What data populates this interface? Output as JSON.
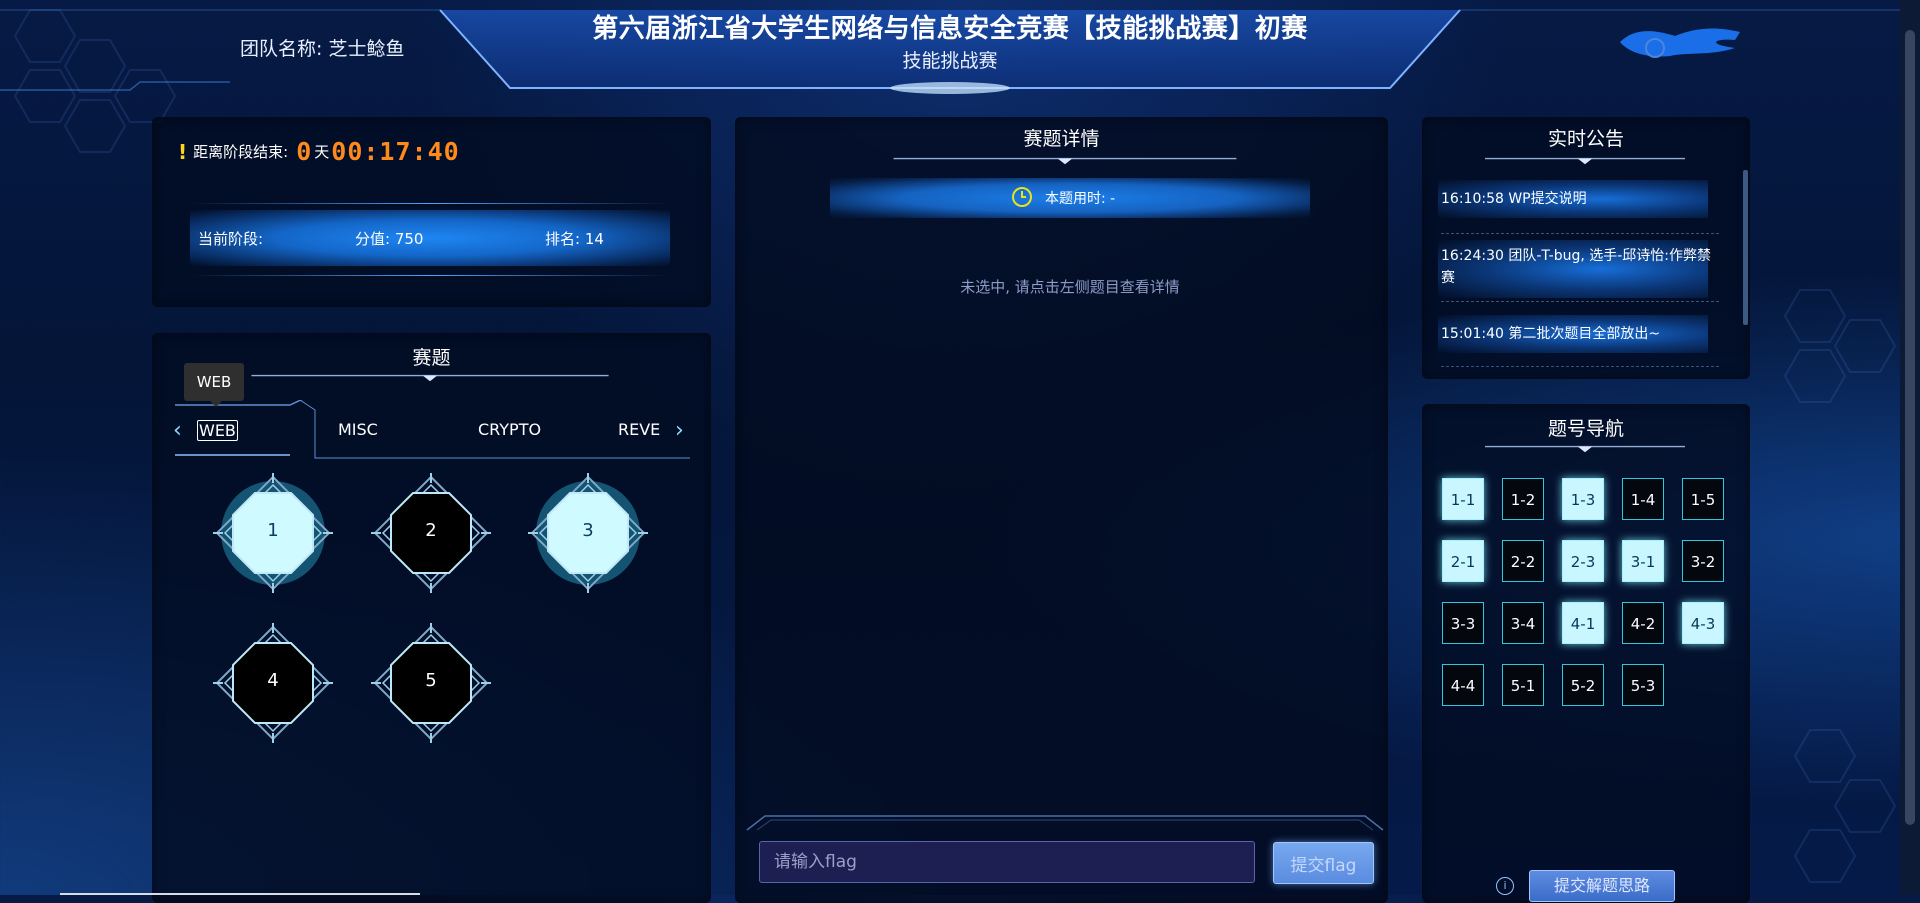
{
  "header": {
    "team_label": "团队名称: 芝士鲶鱼",
    "title": "第六届浙江省大学生网络与信息安全竞赛【技能挑战赛】初赛",
    "subtitle": "技能挑战赛"
  },
  "status": {
    "countdown_label": "距离阶段结束:",
    "days": "0",
    "day_unit": "天",
    "time": "00:17:40",
    "stage_label": "当前阶段:",
    "score_label": "分值: 750",
    "rank_label": "排名: 14"
  },
  "challenges": {
    "title": "赛题",
    "tooltip": "WEB",
    "tabs": [
      "WEB",
      "MISC",
      "CRYPTO",
      "REVE"
    ],
    "active_tab": "WEB",
    "items": [
      {
        "label": "1",
        "solved": true
      },
      {
        "label": "2",
        "solved": false
      },
      {
        "label": "3",
        "solved": true
      },
      {
        "label": "4",
        "solved": false
      },
      {
        "label": "5",
        "solved": false
      }
    ]
  },
  "detail": {
    "title": "赛题详情",
    "time_used": "本题用时: -",
    "hint": "未选中, 请点击左侧题目查看详情",
    "flag_placeholder": "请输入flag",
    "submit_label": "提交flag"
  },
  "announcements": {
    "title": "实时公告",
    "items": [
      {
        "text": "16:10:58   WP提交说明"
      },
      {
        "text": "16:24:30   团队-T-bug, 选手-邱诗怡:作弊禁赛"
      },
      {
        "text": "15:01:40   第二批次题目全部放出~"
      }
    ]
  },
  "navigator": {
    "title": "题号导航",
    "cells": [
      {
        "label": "1-1",
        "solved": true
      },
      {
        "label": "1-2",
        "solved": false
      },
      {
        "label": "1-3",
        "solved": true
      },
      {
        "label": "1-4",
        "solved": false
      },
      {
        "label": "1-5",
        "solved": false
      },
      {
        "label": "2-1",
        "solved": true
      },
      {
        "label": "2-2",
        "solved": false
      },
      {
        "label": "2-3",
        "solved": true
      },
      {
        "label": "3-1",
        "solved": true
      },
      {
        "label": "3-2",
        "solved": false
      },
      {
        "label": "3-3",
        "solved": false
      },
      {
        "label": "3-4",
        "solved": false
      },
      {
        "label": "4-1",
        "solved": true
      },
      {
        "label": "4-2",
        "solved": false
      },
      {
        "label": "4-3",
        "solved": true
      },
      {
        "label": "4-4",
        "solved": false
      },
      {
        "label": "5-1",
        "solved": false
      },
      {
        "label": "5-2",
        "solved": false
      },
      {
        "label": "5-3",
        "solved": false
      }
    ],
    "wp_button": "提交解题思路"
  },
  "colors": {
    "accent": "#1e86f2",
    "countdown": "#ff8a1c",
    "solved": "#c9f6ff",
    "unsolved": "#05070f",
    "border": "#2fc6e0"
  }
}
